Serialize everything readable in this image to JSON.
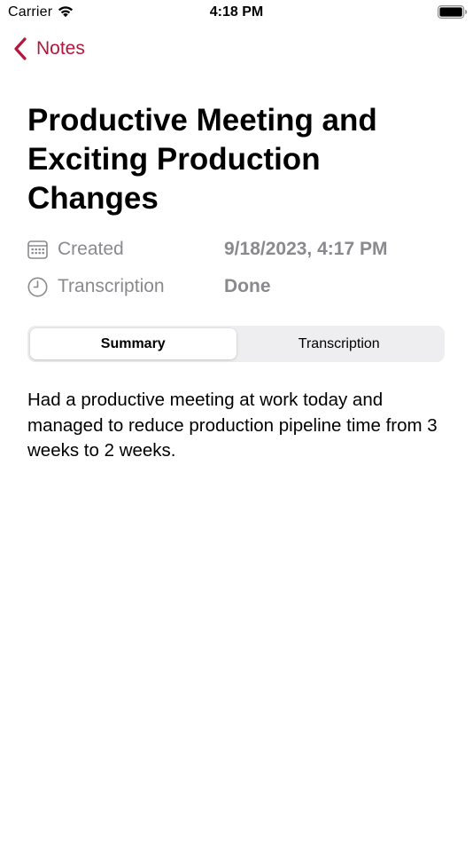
{
  "status_bar": {
    "carrier": "Carrier",
    "time": "4:18 PM",
    "wifi_icon": "wifi-icon",
    "battery_icon": "battery-icon"
  },
  "nav": {
    "back_label": "Notes",
    "back_icon": "chevron-left-icon",
    "accent_color": "#b3173d"
  },
  "note": {
    "title": "Productive Meeting and Exciting Production Changes",
    "meta": [
      {
        "icon": "calendar-icon",
        "label": "Created",
        "value": "9/18/2023, 4:17 PM"
      },
      {
        "icon": "clock-icon",
        "label": "Transcription",
        "value": "Done"
      }
    ],
    "tabs": [
      {
        "label": "Summary",
        "selected": true
      },
      {
        "label": "Transcription",
        "selected": false
      }
    ],
    "summary": "Had a productive meeting at work today and managed to reduce production pipeline time from 3 weeks to 2 weeks."
  }
}
